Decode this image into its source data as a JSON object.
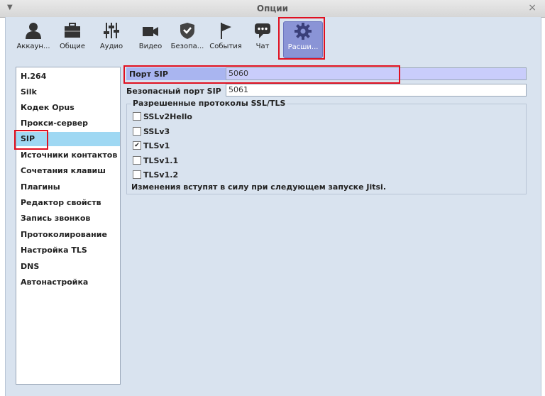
{
  "window": {
    "title": "Опции"
  },
  "toolbar": {
    "tabs": [
      {
        "label": "Аккаун...",
        "icon": "user-icon"
      },
      {
        "label": "Общие",
        "icon": "briefcase-icon"
      },
      {
        "label": "Аудио",
        "icon": "sliders-icon"
      },
      {
        "label": "Видео",
        "icon": "video-camera-icon"
      },
      {
        "label": "Безопа...",
        "icon": "shield-icon"
      },
      {
        "label": "События",
        "icon": "flag-icon"
      },
      {
        "label": "Чат",
        "icon": "chat-bubble-icon"
      },
      {
        "label": "Расши...",
        "icon": "gear-icon"
      }
    ]
  },
  "sidebar": {
    "items": [
      {
        "label": "H.264"
      },
      {
        "label": "Silk"
      },
      {
        "label": "Кодек Opus"
      },
      {
        "label": "Прокси-сервер"
      },
      {
        "label": "SIP"
      },
      {
        "label": "Источники контактов"
      },
      {
        "label": "Сочетания клавиш"
      },
      {
        "label": "Плагины"
      },
      {
        "label": "Редактор свойств"
      },
      {
        "label": "Запись звонков"
      },
      {
        "label": "Протоколирование"
      },
      {
        "label": "Настройка TLS"
      },
      {
        "label": "DNS"
      },
      {
        "label": "Автонастройка"
      }
    ],
    "selected": "SIP"
  },
  "sip": {
    "port_label": "Порт SIP",
    "port_value": "5060",
    "secure_port_label": "Безопасный порт SIP",
    "secure_port_value": "5061",
    "protocols_title": "Разрешенные протоколы SSL/TLS",
    "protocols": [
      {
        "label": "SSLv2Hello",
        "checked": false
      },
      {
        "label": "SSLv3",
        "checked": false
      },
      {
        "label": "TLSv1",
        "checked": true
      },
      {
        "label": "TLSv1.1",
        "checked": false
      },
      {
        "label": "TLSv1.2",
        "checked": false
      }
    ],
    "note": "Изменения вступят в силу при следующем запуске Jitsi."
  },
  "colors": {
    "panel": "#d9e3ef",
    "selected_tab": "#8a94d6",
    "selected_item": "#9fd8f3",
    "highlight": "#e01020"
  }
}
